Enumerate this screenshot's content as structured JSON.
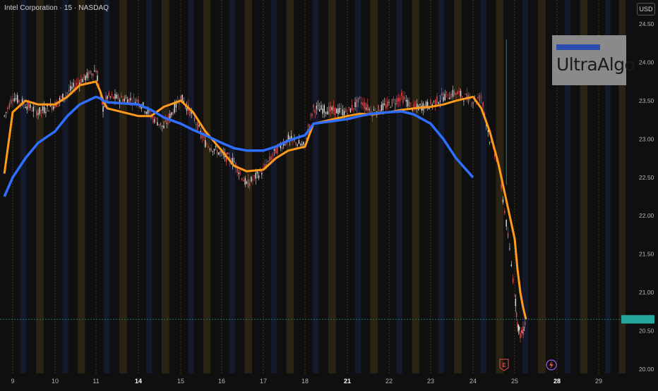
{
  "header": {
    "symbol_title": "Intel Corporation · 15 · NASDAQ",
    "currency": "USD"
  },
  "logo": {
    "text": "UltraAlgo"
  },
  "markers": {
    "earnings": "E"
  },
  "colors": {
    "background": "#0f0f0f",
    "blue_ma": "#2f6fff",
    "orange_ma": "#ff9a1a",
    "candle_up": "#e0e0e0",
    "candle_down": "#e05050",
    "price_label": "#26a69a",
    "band_orange": "#2a2212",
    "band_blue": "#141a2c"
  },
  "chart_data": {
    "type": "line",
    "title": "",
    "xlabel": "",
    "ylabel": "",
    "x_tick_labels": [
      "9",
      "10",
      "11",
      "14",
      "15",
      "16",
      "17",
      "18",
      "21",
      "22",
      "23",
      "24",
      "25",
      "28",
      "29"
    ],
    "bold_x_ticks": [
      "14",
      "21",
      "28"
    ],
    "y_tick_labels": [
      "24.50",
      "24.00",
      "23.50",
      "23.00",
      "22.50",
      "22.00",
      "21.50",
      "21.00",
      "20.50",
      "20.00"
    ],
    "ylim": [
      20.0,
      24.5
    ],
    "x": [
      8.8,
      9.0,
      9.3,
      9.6,
      10.0,
      10.3,
      10.6,
      11.0,
      11.3,
      11.5,
      11.8,
      14.0,
      14.3,
      14.6,
      15.0,
      15.3,
      15.6,
      16.0,
      16.3,
      16.6,
      17.0,
      17.3,
      17.6,
      18.0,
      18.3,
      18.6,
      21.0,
      21.3,
      21.6,
      22.0,
      22.3,
      22.6,
      23.0,
      23.3,
      23.6,
      24.0,
      24.2,
      24.4,
      24.6,
      24.8,
      25.0,
      25.2,
      25.4,
      25.6,
      25.8
    ],
    "series": [
      {
        "values": [
          23.3,
          23.55,
          23.45,
          23.35,
          23.45,
          23.6,
          23.75,
          23.9,
          23.6,
          23.4,
          23.55,
          23.5,
          23.3,
          23.15,
          23.55,
          23.3,
          22.95,
          22.8,
          22.7,
          22.4,
          22.6,
          22.85,
          23.0,
          22.9,
          23.2,
          23.4,
          23.35,
          23.5,
          23.35,
          23.45,
          23.55,
          23.4,
          23.45,
          23.55,
          23.6,
          23.5,
          23.55,
          23.0,
          22.7,
          21.9,
          21.0,
          20.6,
          20.45,
          20.5,
          20.65
        ]
      },
      {
        "values": [
          22.55,
          23.35,
          23.5,
          23.45,
          23.45,
          23.55,
          23.7,
          23.75,
          23.62,
          23.5,
          23.4,
          23.3,
          23.3,
          23.42,
          23.5,
          23.35,
          23.1,
          22.85,
          22.65,
          22.58,
          22.6,
          22.75,
          22.85,
          22.9,
          23.05,
          23.2,
          23.3,
          23.33,
          23.32,
          23.35,
          23.38,
          23.4,
          23.42,
          23.45,
          23.5,
          23.55,
          23.4,
          23.1,
          22.7,
          22.2,
          21.7,
          21.3,
          21.0,
          20.8,
          20.65
        ]
      },
      {
        "values": [
          22.25,
          22.5,
          22.75,
          22.95,
          23.1,
          23.3,
          23.45,
          23.55,
          23.53,
          23.5,
          23.48,
          23.45,
          23.38,
          23.28,
          23.2,
          23.12,
          23.05,
          22.95,
          22.88,
          22.85,
          22.85,
          22.9,
          22.98,
          23.05,
          23.12,
          23.2,
          23.26,
          23.3,
          23.33,
          23.35,
          23.36,
          23.32,
          23.2,
          23.0,
          22.75,
          22.5
        ]
      }
    ],
    "last_price": 20.65,
    "x_axis_note": "calendar day numbers"
  }
}
